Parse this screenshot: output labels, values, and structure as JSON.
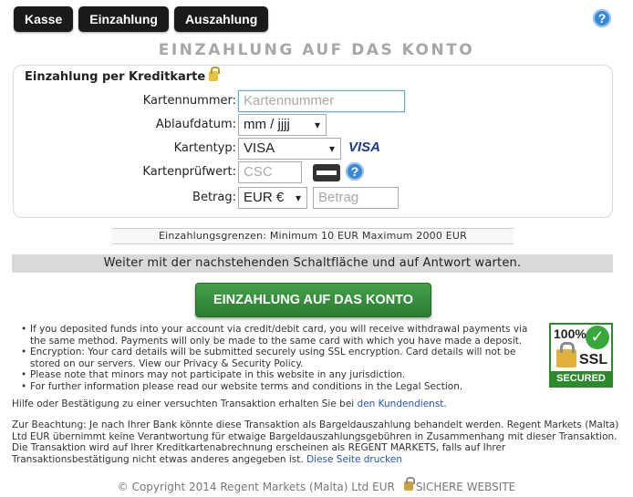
{
  "tabs": [
    "Kasse",
    "Einzahlung",
    "Auszahlung"
  ],
  "help_icon_label": "?",
  "page_title": "EINZAHLUNG AUF DAS KONTO",
  "form": {
    "title": "Einzahlung per Kreditkarte",
    "card_number": {
      "label": "Kartennummer:",
      "placeholder": "Kartennummer"
    },
    "expiry": {
      "label": "Ablaufdatum:",
      "value": "mm / jjjj"
    },
    "card_type": {
      "label": "Kartentyp:",
      "value": "VISA",
      "logo_text": "VISA"
    },
    "csc": {
      "label": "Kartenprüfwert:",
      "placeholder": "CSC"
    },
    "amount": {
      "label": "Betrag:",
      "currency": "EUR €",
      "placeholder": "Betrag"
    }
  },
  "limits_text": "Einzahlungsgrenzen: Minimum 10 EUR Maximum 2000 EUR",
  "notice_text": "Weiter mit der nachstehenden Schaltfläche und auf Antwort warten.",
  "submit_label": "EINZAHLUNG AUF DAS KONTO",
  "info_items": [
    "If you deposited funds into your account via credit/debit card, you will receive withdrawal payments via the same method. Payments will only be made to the same card with which you have made a deposit.",
    "Encryption: Your card details will be submitted securely using SSL encryption. Card details will not be stored on our servers. View our Privacy & Security Policy.",
    "Please note that minors may not participate in this website in any jurisdiction.",
    "For further information please read our website terms and conditions in the Legal Section."
  ],
  "ssl_badge": {
    "percent": "100%",
    "check": "✓",
    "text": "SSL",
    "secured": "SECURED"
  },
  "help_line": {
    "text": "Hilfe oder Bestätigung zu einer versuchten Transaktion erhalten Sie bei",
    "link": "den Kundendienst",
    "suffix": "."
  },
  "note": {
    "text": "Zur Beachtung: Je nach Ihrer Bank könnte diese Transaktion als Bargeldauszahlung behandelt werden. Regent Markets (Malta) Ltd EUR übernimmt keine Verantwortung für etwaige Bargeldauszahlungsgebühren in Zusammenhang mit dieser Transaktion. Die Transaktion wird auf Ihrer Kreditkartenabrechnung erscheinen als REGENT MARKETS, falls auf Ihrer Transaktionsbestätigung nicht etwas anderes angegeben ist.",
    "link": "Diese Seite drucken"
  },
  "footer": {
    "copyright": "© Copyright 2014 Regent Markets (Malta) Ltd EUR",
    "secure": "SICHERE WEBSITE"
  }
}
